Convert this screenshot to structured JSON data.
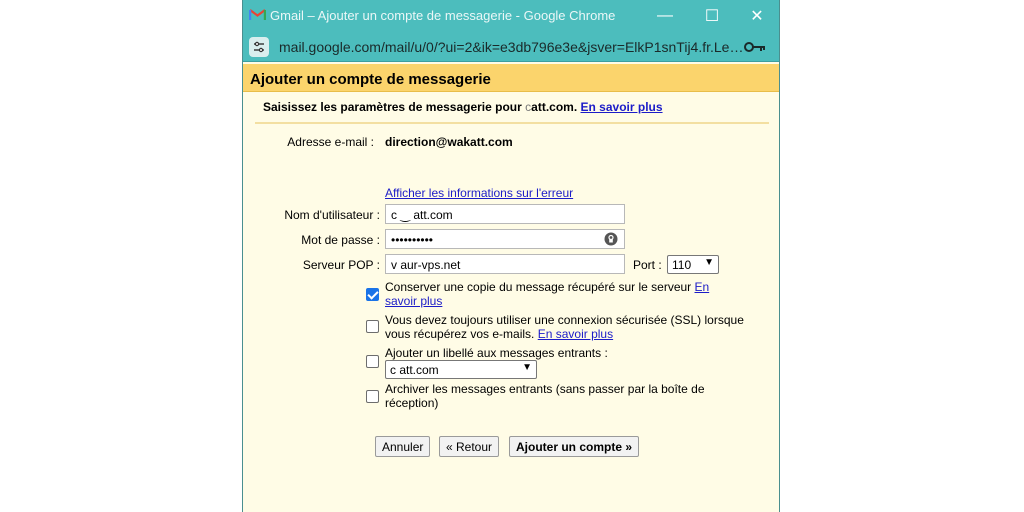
{
  "window": {
    "title": "Gmail – Ajouter un compte de messagerie - Google Chrome",
    "url": "mail.google.com/mail/u/0/?ui=2&ik=e3db796e3e&jsver=ElkP1snTij4.fr.Le…",
    "controls": {
      "minimize": "—",
      "maximize": "☐",
      "close": "✕"
    }
  },
  "dialog": {
    "header": "Ajouter un compte de messagerie",
    "subheading_prefix": "Saisissez les paramètres de messagerie pour ",
    "subheading_masked": "c                       ",
    "subheading_suffix": "att.com.",
    "learn_more": "En savoir plus",
    "email_label": "Adresse e-mail :",
    "email_value": "direction@wakatt.com",
    "error_link": "Afficher les informations sur l'erreur",
    "username_label": "Nom d'utilisateur :",
    "username_value": "c                    ‿    att.com",
    "password_label": "Mot de passe :",
    "password_value": "••••••••••",
    "pop_label": "Serveur POP :",
    "pop_value": "v                        aur-vps.net",
    "port_label": "Port :",
    "port_value": "110",
    "options": [
      {
        "text": "Conserver une copie du message récupéré sur le serveur ",
        "link": "En savoir plus",
        "checked": true
      },
      {
        "text": "Vous devez toujours utiliser une connexion sécurisée (SSL) lorsque vous récupérez vos e-mails. ",
        "link": "En savoir plus",
        "checked": false
      },
      {
        "text": "Ajouter un libellé aux messages entrants :",
        "select_value": "c                    att.com",
        "checked": false
      },
      {
        "text": "Archiver les messages entrants (sans passer par la boîte de réception)",
        "checked": false
      }
    ],
    "buttons": {
      "cancel": "Annuler",
      "back": "« Retour",
      "add": "Ajouter un compte »"
    }
  },
  "colors": {
    "titlebar": "#4cbdbd",
    "dialog_header": "#fbd46c",
    "dialog_background": "#fffce6",
    "link": "#1c1cc8",
    "checkbox_checked": "#1a73e8"
  }
}
